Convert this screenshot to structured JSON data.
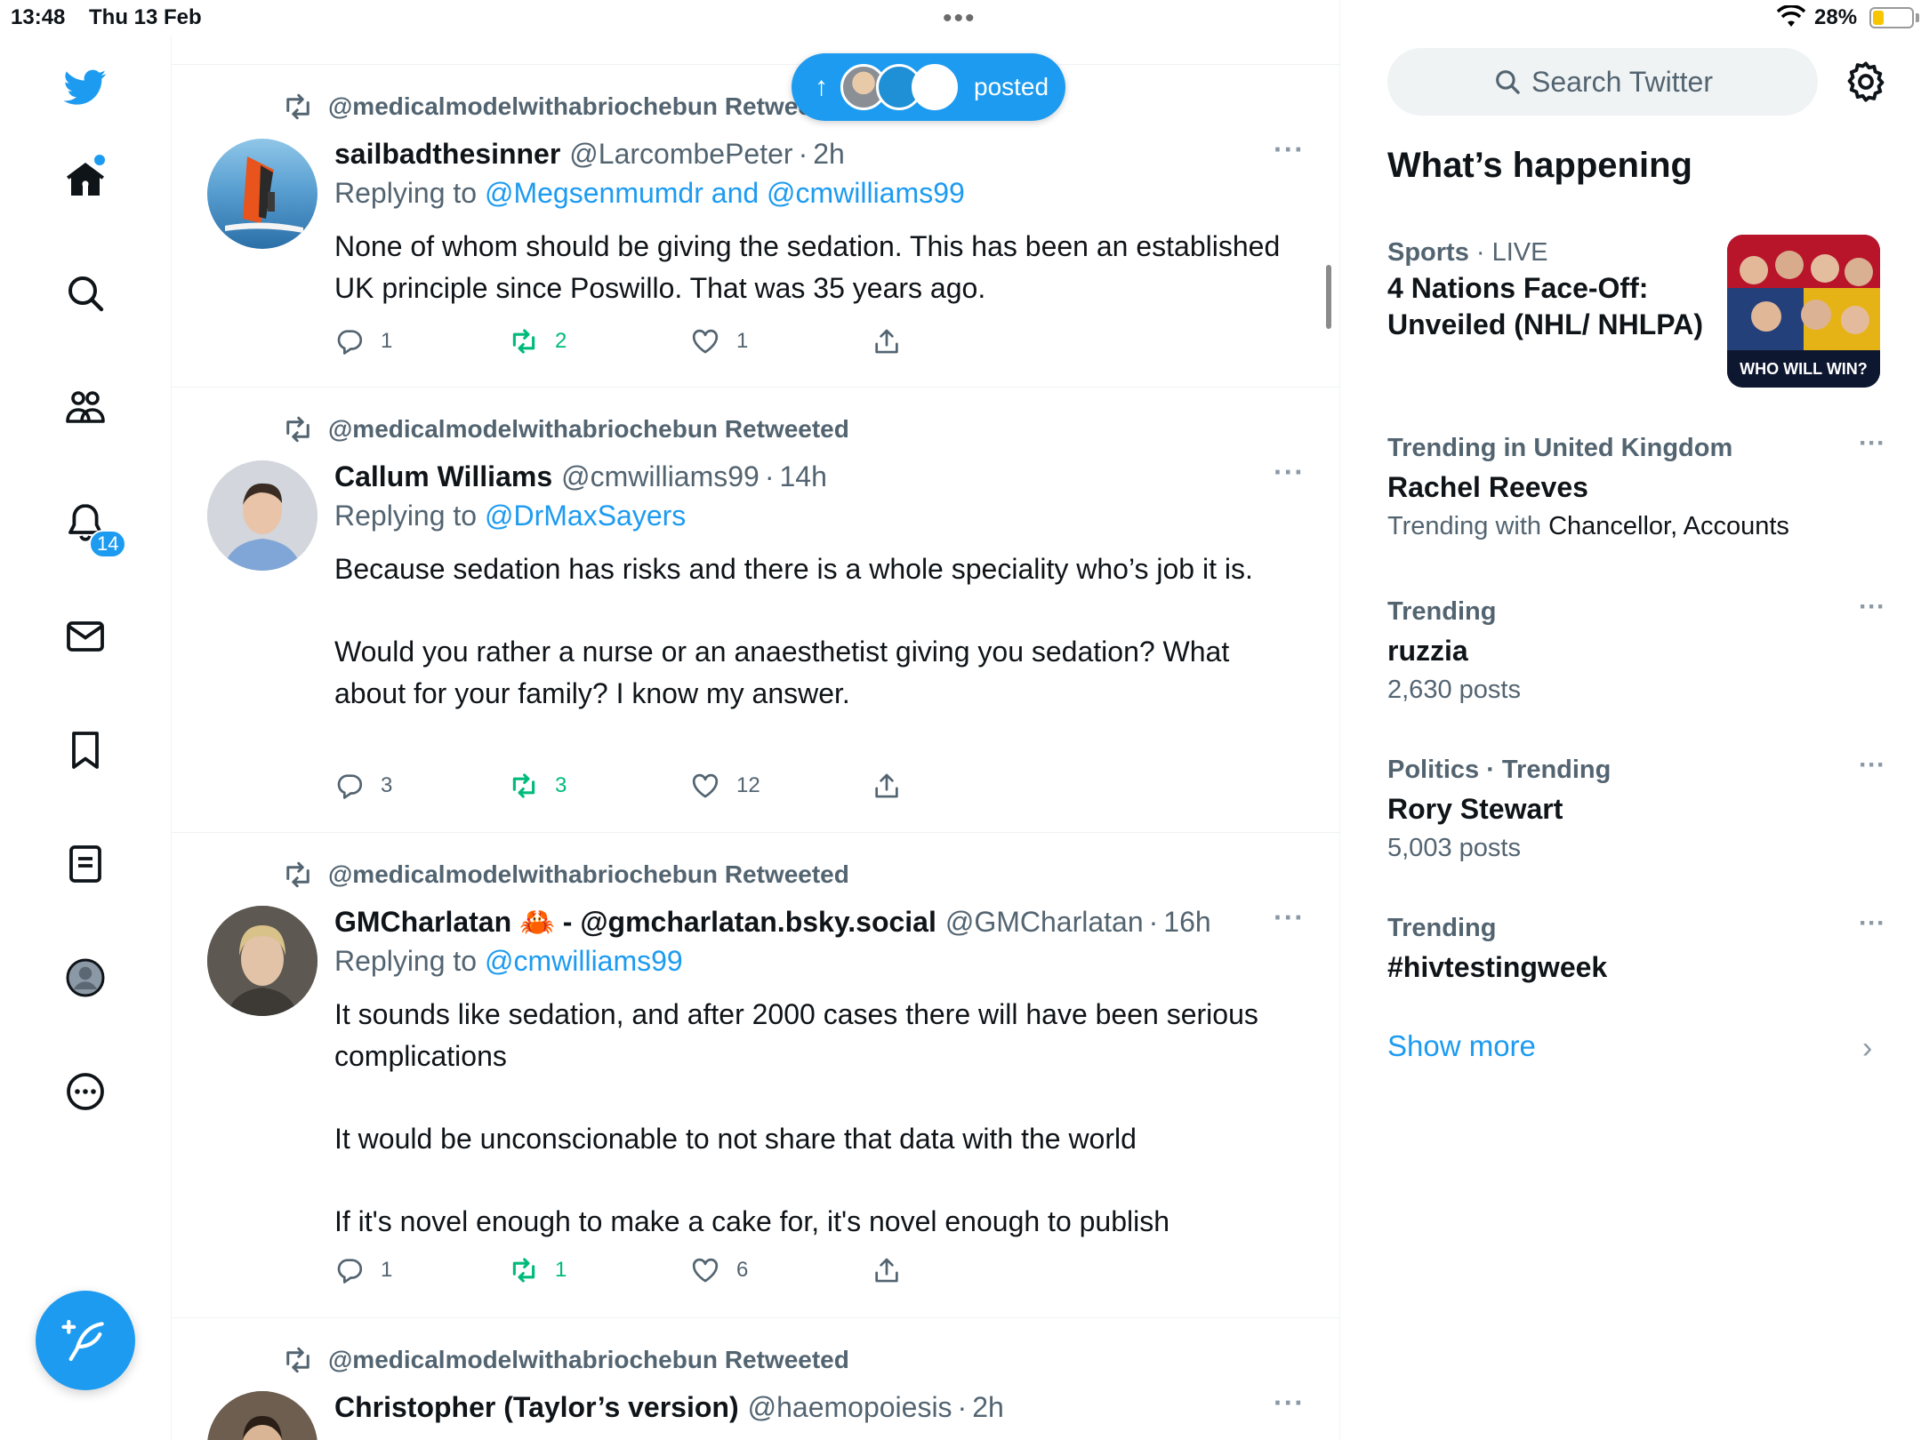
{
  "status_bar": {
    "time": "13:48",
    "date": "Thu 13 Feb",
    "battery_pct": "28%",
    "battery_level": 0.28
  },
  "nav": {
    "notifications_badge": "14"
  },
  "new_posts_pill": {
    "label": "posted"
  },
  "tweets": [
    {
      "retweeted_by": "@medicalmodelwithabriochebun Retweeted",
      "name": "sailbadthesinner",
      "handle": "@LarcombePeter",
      "sep": "·",
      "time": "2h",
      "replying_prefix": "Replying to",
      "replying_to": "@Megsenmumdr and @cmwilliams99",
      "body": [
        "None of whom should be giving the sedation. This has been an established UK principle since Poswillo. That was 35 years ago."
      ],
      "replies": "1",
      "retweets": "2",
      "likes": "1"
    },
    {
      "retweeted_by": "@medicalmodelwithabriochebun Retweeted",
      "name": "Callum Williams",
      "handle": "@cmwilliams99",
      "sep": "·",
      "time": "14h",
      "replying_prefix": "Replying to",
      "replying_to": "@DrMaxSayers",
      "body": [
        "Because sedation has risks and there is a whole speciality who’s job it is.",
        "Would you rather a nurse or an anaesthetist giving you sedation? What about for your family? I know my answer."
      ],
      "replies": "3",
      "retweets": "3",
      "likes": "12"
    },
    {
      "retweeted_by": "@medicalmodelwithabriochebun Retweeted",
      "name": "GMCharlatan 🦀 - @gmcharlatan.bsky.social",
      "handle": "@GMCharlatan",
      "sep": "·",
      "time": "16h",
      "replying_prefix": "Replying to",
      "replying_to": "@cmwilliams99",
      "body": [
        "It sounds like sedation, and after 2000 cases there will have been serious complications",
        "It would be unconscionable to not share that data with the world",
        "If it's novel enough to make a cake for, it's novel enough to publish"
      ],
      "replies": "1",
      "retweets": "1",
      "likes": "6"
    },
    {
      "retweeted_by": "@medicalmodelwithabriochebun Retweeted",
      "name": "Christopher (Taylor’s version)",
      "handle": "@haemopoiesis",
      "sep": "·",
      "time": "2h"
    }
  ],
  "sidebar": {
    "search_placeholder": "Search Twitter",
    "title": "What’s happening",
    "trends": [
      {
        "category": "Sports",
        "sep": " · ",
        "status": "LIVE",
        "title": "4 Nations Face-Off: Unveiled (NHL/ NHLPA)",
        "image_caption": "WHO WILL WIN?"
      },
      {
        "category": "Trending in United Kingdom",
        "title": "Rachel Reeves",
        "with_prefix": "Trending with",
        "with_terms": "Chancellor, Accounts"
      },
      {
        "category": "Trending",
        "title": "ruzzia",
        "count": "2,630 posts"
      },
      {
        "category": "Politics · Trending",
        "title": "Rory Stewart",
        "count": "5,003 posts"
      },
      {
        "category": "Trending",
        "title": "#hivtestingweek"
      }
    ],
    "show_more": "Show more"
  },
  "colors": {
    "accent": "#1d9bf0",
    "retweet_green": "#00ba7c",
    "muted": "#536471"
  }
}
